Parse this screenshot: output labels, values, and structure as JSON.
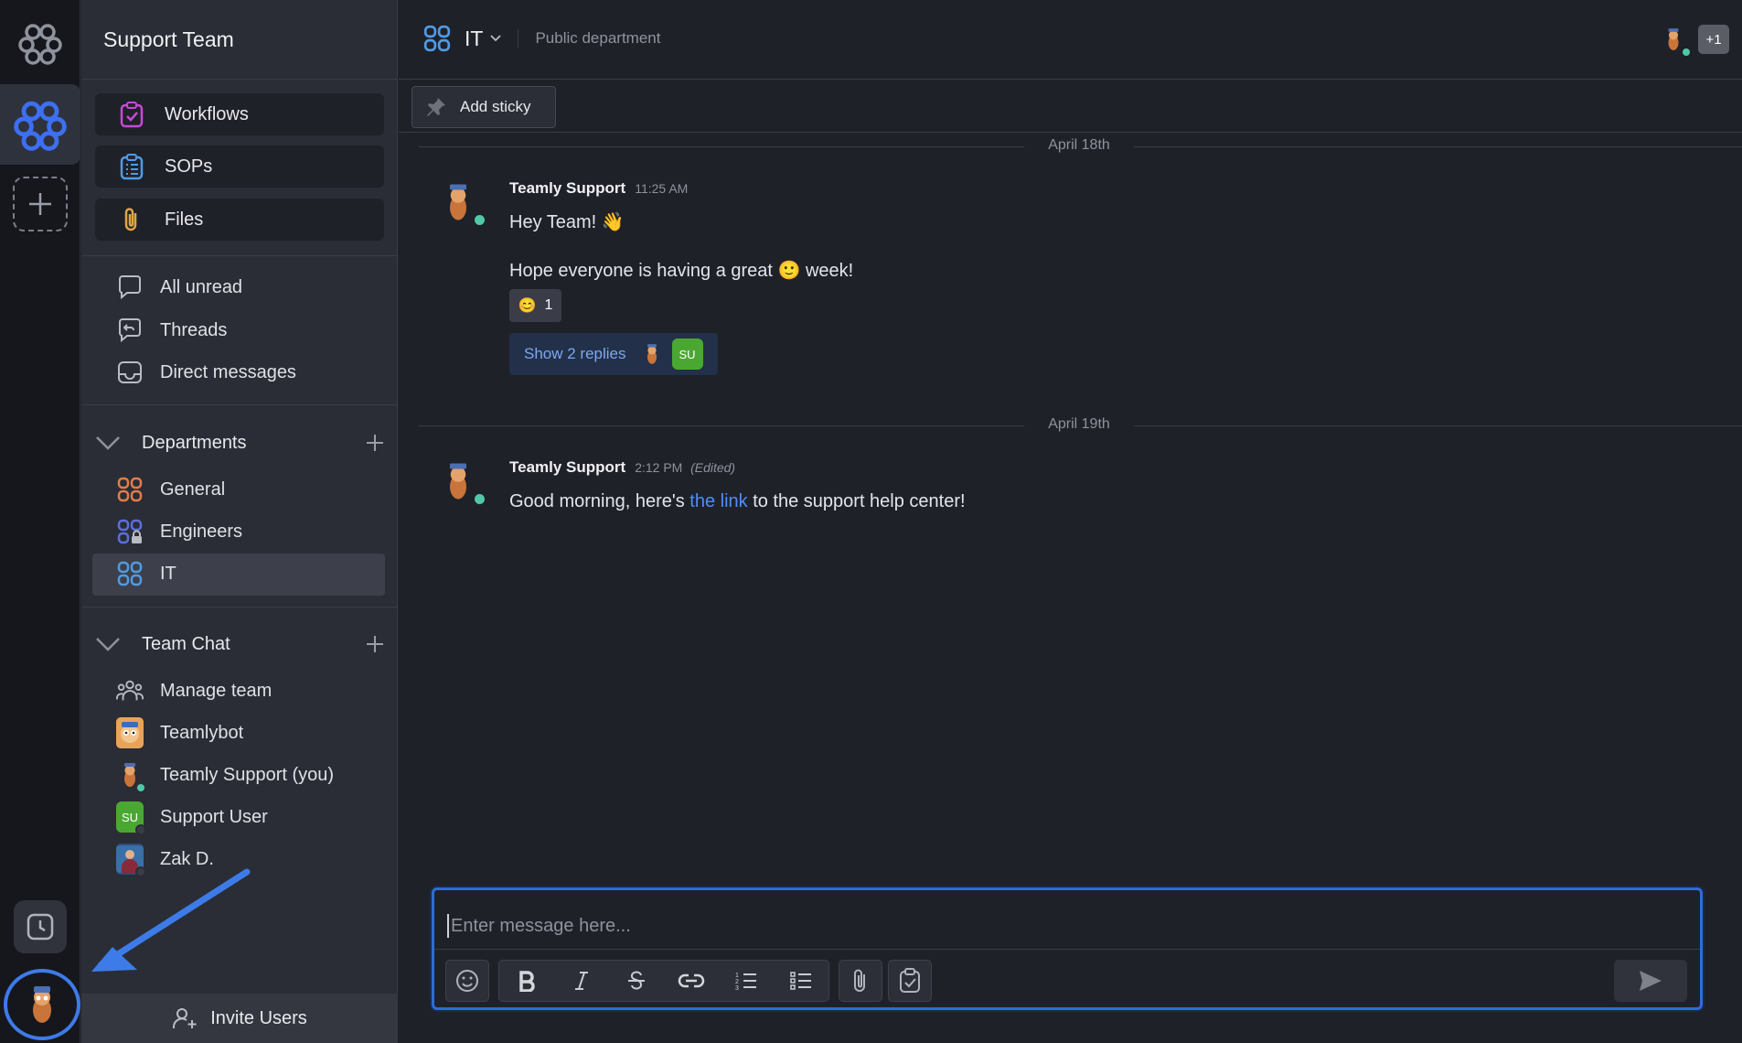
{
  "sidebar": {
    "team_name": "Support Team",
    "tools": [
      {
        "label": "Workflows",
        "icon": "clipboard-check-icon"
      },
      {
        "label": "SOPs",
        "icon": "list-clipboard-icon"
      },
      {
        "label": "Files",
        "icon": "paperclip-icon"
      }
    ],
    "nav": [
      {
        "label": "All unread",
        "icon": "chat-bubble-icon"
      },
      {
        "label": "Threads",
        "icon": "threads-icon"
      },
      {
        "label": "Direct messages",
        "icon": "inbox-icon"
      }
    ],
    "departments": {
      "title": "Departments",
      "items": [
        {
          "label": "General",
          "color": "#e27d4b"
        },
        {
          "label": "Engineers",
          "color": "#5b6fe0"
        },
        {
          "label": "IT",
          "color": "#4f9be5"
        }
      ]
    },
    "team_chat": {
      "title": "Team Chat",
      "items": [
        {
          "label": "Manage team"
        },
        {
          "label": "Teamlybot"
        },
        {
          "label": "Teamly Support (you)"
        },
        {
          "label": "Support User",
          "initials": "SU"
        },
        {
          "label": "Zak D."
        }
      ]
    },
    "invite_label": "Invite Users"
  },
  "channel": {
    "name": "IT",
    "description": "Public department",
    "extra_members": "+1"
  },
  "toolbar": {
    "sticky_label": "Add sticky"
  },
  "messages": [
    {
      "date": "April 18th",
      "author": "Teamly Support",
      "time": "11:25 AM",
      "line1": "Hey Team! 👋",
      "line2_pre": "Hope everyone is having a great ",
      "line2_emoji": "🙂",
      "line2_post": " week!",
      "reaction_emoji": "😊",
      "reaction_count": "1",
      "replies_label": "Show 2 replies",
      "reply_initials": "SU"
    },
    {
      "date": "April 19th",
      "author": "Teamly Support",
      "time": "2:12 PM",
      "edited": "(Edited)",
      "text_pre": "Good morning, here's ",
      "link": "the link",
      "text_post": " to the support help center!"
    }
  ],
  "composer": {
    "placeholder": "Enter message here..."
  },
  "colors": {
    "accent": "#3d7be8",
    "online": "#4ec9a6"
  }
}
